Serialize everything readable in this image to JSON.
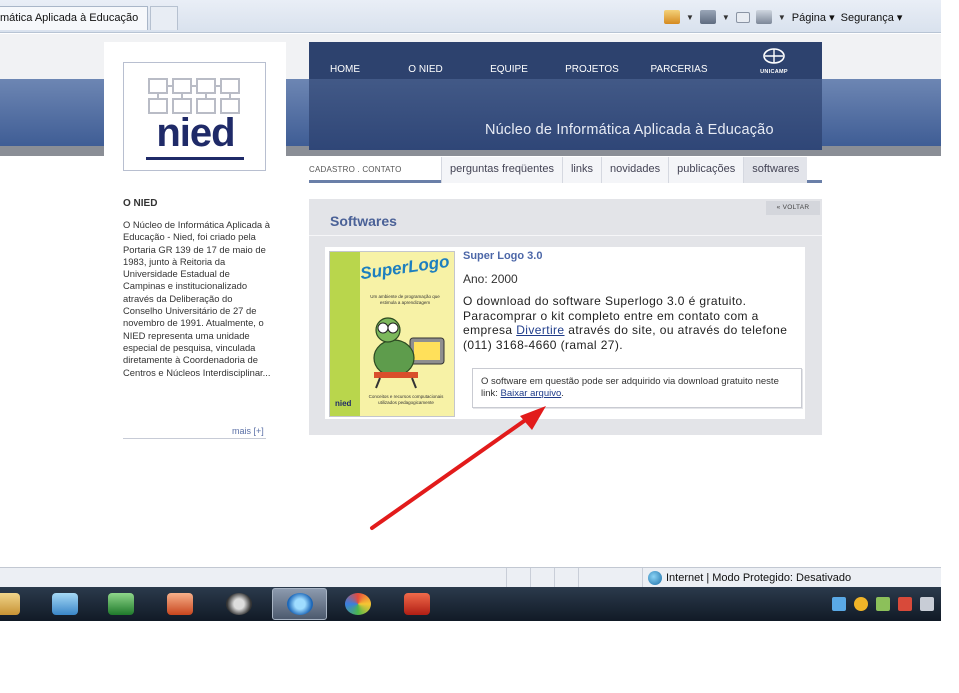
{
  "browser": {
    "tab_title": "mática Aplicada à Educação",
    "toolbar": {
      "page_label": "Página",
      "security_label": "Segurança"
    }
  },
  "sidebar": {
    "logo_text": "nied",
    "about_title": "O NIED",
    "about_text": "O Núcleo de Informática Aplicada à Educação - Nied, foi criado pela Portaria GR 139 de 17 de maio de 1983, junto à Reitoria da Universidade Estadual de Campinas e institucionalizado através da Deliberação do Conselho Universitário de 27 de novembro de 1991. Atualmente, o NIED representa uma unidade especial de pesquisa, vinculada diretamente à Coordenadoria de Centros e Núcleos Interdisciplinar...",
    "more_link": "mais [+]"
  },
  "header": {
    "nav": [
      "HOME",
      "O NIED",
      "EQUIPE",
      "PROJETOS",
      "PARCERIAS"
    ],
    "unicamp_label": "UNICAMP",
    "site_title": "Núcleo de Informática Aplicada à Educação"
  },
  "subnav": {
    "left_text": "CADASTRO  .  CONTATO",
    "tabs": [
      "perguntas freqüentes",
      "links",
      "novidades",
      "publicações",
      "softwares"
    ],
    "active_tab": "softwares"
  },
  "content": {
    "section_title": "Softwares",
    "back_label": "« VOLTAR",
    "software": {
      "title": "Super Logo 3.0",
      "year": "Ano: 2000",
      "desc_before_link": "O download do software Superlogo 3.0 é gratuito. Paracomprar o kit completo entre em contato com a empresa ",
      "desc_link": "Divertire",
      "desc_after_link": " através do site, ou através do telefone (011) 3168-4660 (ramal 27)."
    },
    "download": {
      "text": "O software em questão pode ser adquirido via download gratuito neste link: ",
      "link_label": "Baixar arquivo",
      "after": "."
    },
    "cover": {
      "title": "SuperLogo",
      "subtitle": "Um ambiente de programação que estimula a aprendizagem",
      "footer": "Conceitos e recursos computacionais utilizados pedagogicamente",
      "logo": "nied"
    }
  },
  "statusbar": {
    "zone_text": "Internet | Modo Protegido: Desativado"
  },
  "colors": {
    "header_blue": "#2d426e",
    "accent_blue": "#4a6197",
    "arrow_red": "#e21b1b"
  }
}
